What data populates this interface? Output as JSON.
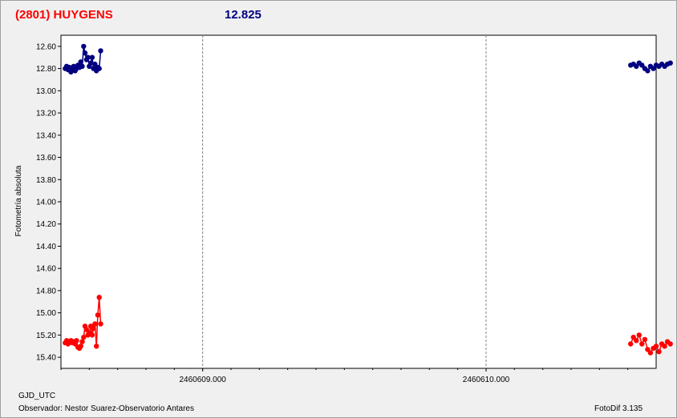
{
  "header": {
    "object": "(2801) HUYGENS",
    "magnitude": "12.825"
  },
  "footer": {
    "xaxis_name": "GJD_UTC",
    "observer": "Observador: Nestor Suarez-Observatorio Antares",
    "software": "FotoDif 3.135"
  },
  "colors": {
    "series_target": "#000080",
    "series_comparison": "#ff0000"
  },
  "chart_data": {
    "type": "line",
    "title": "(2801) HUYGENS",
    "ylabel": "Fotometría absoluta",
    "xlabel": "GJD_UTC",
    "ylim": [
      12.5,
      15.5
    ],
    "y_inverted": true,
    "y_ticks": [
      12.6,
      12.8,
      13.0,
      13.2,
      13.4,
      13.6,
      13.8,
      14.0,
      14.2,
      14.4,
      14.6,
      14.8,
      15.0,
      15.2,
      15.4
    ],
    "y_tick_labels": [
      "12.60",
      "12.80",
      "13.00",
      "13.20",
      "13.40",
      "13.60",
      "13.80",
      "14.00",
      "14.20",
      "14.40",
      "14.60",
      "14.80",
      "15.00",
      "15.20",
      "15.40"
    ],
    "xlim": [
      2460608.5,
      2460610.6
    ],
    "x_ticks": [
      2460609.0,
      2460610.0
    ],
    "x_tick_labels": [
      "2460609.000",
      "2460610.000"
    ],
    "grid": true,
    "series": [
      {
        "color": "#000080",
        "x": [
          2460608.515,
          2460608.52,
          2460608.525,
          2460608.53,
          2460608.535,
          2460608.54,
          2460608.545,
          2460608.55,
          2460608.555,
          2460608.56,
          2460608.565,
          2460608.57,
          2460608.575,
          2460608.58,
          2460608.585,
          2460608.59,
          2460608.595,
          2460608.6,
          2460608.605,
          2460608.61,
          2460608.615,
          2460608.62,
          2460608.625,
          2460608.63,
          2460608.635,
          2460608.64,
          2460610.51,
          2460610.52,
          2460610.53,
          2460610.54,
          2460610.55,
          2460610.56,
          2460610.57,
          2460610.58,
          2460610.59,
          2460610.6,
          2460610.61,
          2460610.62,
          2460610.63,
          2460610.64,
          2460610.65
        ],
        "y": [
          12.8,
          12.78,
          12.81,
          12.79,
          12.83,
          12.8,
          12.78,
          12.82,
          12.8,
          12.77,
          12.79,
          12.74,
          12.78,
          12.6,
          12.66,
          12.72,
          12.7,
          12.78,
          12.75,
          12.7,
          12.8,
          12.76,
          12.82,
          12.79,
          12.8,
          12.64,
          12.77,
          12.76,
          12.78,
          12.75,
          12.77,
          12.8,
          12.82,
          12.78,
          12.8,
          12.77,
          12.78,
          12.76,
          12.78,
          12.76,
          12.75
        ]
      },
      {
        "color": "#ff0000",
        "x": [
          2460608.515,
          2460608.52,
          2460608.525,
          2460608.53,
          2460608.535,
          2460608.54,
          2460608.545,
          2460608.55,
          2460608.555,
          2460608.56,
          2460608.565,
          2460608.57,
          2460608.575,
          2460608.58,
          2460608.585,
          2460608.59,
          2460608.595,
          2460608.6,
          2460608.605,
          2460608.61,
          2460608.615,
          2460608.62,
          2460608.625,
          2460608.63,
          2460608.635,
          2460608.64,
          2460610.51,
          2460610.52,
          2460610.53,
          2460610.54,
          2460610.55,
          2460610.56,
          2460610.57,
          2460610.58,
          2460610.59,
          2460610.6,
          2460610.61,
          2460610.62,
          2460610.63,
          2460610.64,
          2460610.65
        ],
        "y": [
          15.27,
          15.25,
          15.28,
          15.26,
          15.25,
          15.27,
          15.26,
          15.28,
          15.25,
          15.31,
          15.32,
          15.3,
          15.26,
          15.22,
          15.12,
          15.15,
          15.2,
          15.18,
          15.12,
          15.2,
          15.14,
          15.1,
          15.3,
          15.02,
          14.86,
          15.1,
          15.28,
          15.22,
          15.25,
          15.2,
          15.28,
          15.24,
          15.33,
          15.36,
          15.32,
          15.3,
          15.35,
          15.28,
          15.3,
          15.26,
          15.28
        ]
      }
    ]
  }
}
